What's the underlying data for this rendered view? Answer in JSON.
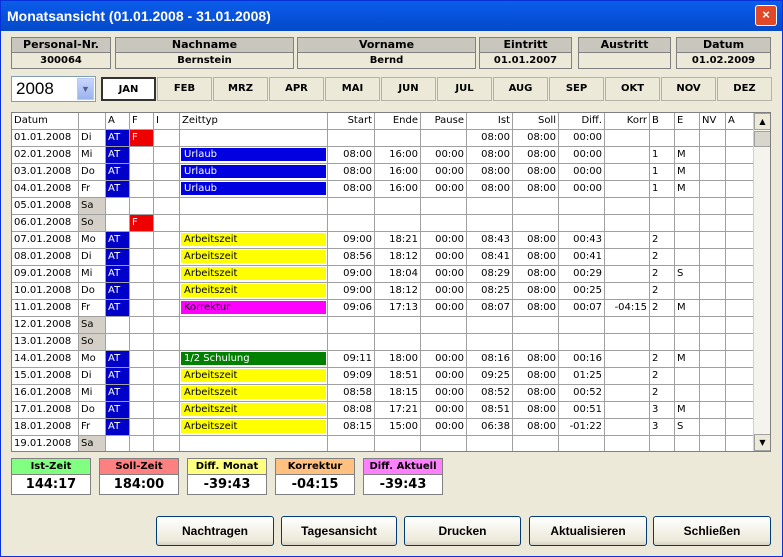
{
  "window": {
    "title": "Monatsansicht (01.01.2008 - 31.01.2008)",
    "close": "×"
  },
  "header": [
    {
      "label": "Personal-Nr.",
      "value": "300064"
    },
    {
      "label": "Nachname",
      "value": "Bernstein"
    },
    {
      "label": "Vorname",
      "value": "Bernd"
    },
    {
      "label": "Eintritt",
      "value": "01.01.2007"
    },
    {
      "label": "Austritt",
      "value": ""
    },
    {
      "label": "Datum",
      "value": "01.02.2009"
    }
  ],
  "year": "2008",
  "months": [
    "JAN",
    "FEB",
    "MRZ",
    "APR",
    "MAI",
    "JUN",
    "JUL",
    "AUG",
    "SEP",
    "OKT",
    "NOV",
    "DEZ"
  ],
  "selected_month": "JAN",
  "columns": [
    "Datum",
    "",
    "A",
    "F",
    "I",
    "Zeittyp",
    "Start",
    "Ende",
    "Pause",
    "Ist",
    "Soll",
    "Diff.",
    "Korr",
    "B",
    "E",
    "NV",
    "A"
  ],
  "rows": [
    {
      "datum": "01.01.2008",
      "tag": "Di",
      "a": "AT",
      "f": "F",
      "zt": "",
      "zc": "",
      "start": "",
      "ende": "",
      "pause": "",
      "ist": "08:00",
      "soll": "08:00",
      "diff": "00:00",
      "korr": "",
      "b": "",
      "e": ""
    },
    {
      "datum": "02.01.2008",
      "tag": "Mi",
      "a": "AT",
      "f": "",
      "zt": "Urlaub",
      "zc": "#0000e0",
      "start": "08:00",
      "ende": "16:00",
      "pause": "00:00",
      "ist": "08:00",
      "soll": "08:00",
      "diff": "00:00",
      "korr": "",
      "b": "1",
      "e": "M"
    },
    {
      "datum": "03.01.2008",
      "tag": "Do",
      "a": "AT",
      "f": "",
      "zt": "Urlaub",
      "zc": "#0000e0",
      "start": "08:00",
      "ende": "16:00",
      "pause": "00:00",
      "ist": "08:00",
      "soll": "08:00",
      "diff": "00:00",
      "korr": "",
      "b": "1",
      "e": "M"
    },
    {
      "datum": "04.01.2008",
      "tag": "Fr",
      "a": "AT",
      "f": "",
      "zt": "Urlaub",
      "zc": "#0000e0",
      "start": "08:00",
      "ende": "16:00",
      "pause": "00:00",
      "ist": "08:00",
      "soll": "08:00",
      "diff": "00:00",
      "korr": "",
      "b": "1",
      "e": "M"
    },
    {
      "datum": "05.01.2008",
      "tag": "Sa",
      "a": "",
      "f": "",
      "zt": "",
      "zc": "",
      "start": "",
      "ende": "",
      "pause": "",
      "ist": "",
      "soll": "",
      "diff": "",
      "korr": "",
      "b": "",
      "e": ""
    },
    {
      "datum": "06.01.2008",
      "tag": "So",
      "a": "",
      "f": "F",
      "zt": "",
      "zc": "",
      "start": "",
      "ende": "",
      "pause": "",
      "ist": "",
      "soll": "",
      "diff": "",
      "korr": "",
      "b": "",
      "e": ""
    },
    {
      "datum": "07.01.2008",
      "tag": "Mo",
      "a": "AT",
      "f": "",
      "zt": "Arbeitszeit",
      "zc": "#ffff00",
      "start": "09:00",
      "ende": "18:21",
      "pause": "00:00",
      "ist": "08:43",
      "soll": "08:00",
      "diff": "00:43",
      "korr": "",
      "b": "2",
      "e": ""
    },
    {
      "datum": "08.01.2008",
      "tag": "Di",
      "a": "AT",
      "f": "",
      "zt": "Arbeitszeit",
      "zc": "#ffff00",
      "start": "08:56",
      "ende": "18:12",
      "pause": "00:00",
      "ist": "08:41",
      "soll": "08:00",
      "diff": "00:41",
      "korr": "",
      "b": "2",
      "e": ""
    },
    {
      "datum": "09.01.2008",
      "tag": "Mi",
      "a": "AT",
      "f": "",
      "zt": "Arbeitszeit",
      "zc": "#ffff00",
      "start": "09:00",
      "ende": "18:04",
      "pause": "00:00",
      "ist": "08:29",
      "soll": "08:00",
      "diff": "00:29",
      "korr": "",
      "b": "2",
      "e": "S"
    },
    {
      "datum": "10.01.2008",
      "tag": "Do",
      "a": "AT",
      "f": "",
      "zt": "Arbeitszeit",
      "zc": "#ffff00",
      "start": "09:00",
      "ende": "18:12",
      "pause": "00:00",
      "ist": "08:25",
      "soll": "08:00",
      "diff": "00:25",
      "korr": "",
      "b": "2",
      "e": ""
    },
    {
      "datum": "11.01.2008",
      "tag": "Fr",
      "a": "AT",
      "f": "",
      "zt": "Korrektur",
      "zc": "#ff00ff",
      "start": "09:06",
      "ende": "17:13",
      "pause": "00:00",
      "ist": "08:07",
      "soll": "08:00",
      "diff": "00:07",
      "korr": "-04:15",
      "b": "2",
      "e": "M"
    },
    {
      "datum": "12.01.2008",
      "tag": "Sa",
      "a": "",
      "f": "",
      "zt": "",
      "zc": "",
      "start": "",
      "ende": "",
      "pause": "",
      "ist": "",
      "soll": "",
      "diff": "",
      "korr": "",
      "b": "",
      "e": ""
    },
    {
      "datum": "13.01.2008",
      "tag": "So",
      "a": "",
      "f": "",
      "zt": "",
      "zc": "",
      "start": "",
      "ende": "",
      "pause": "",
      "ist": "",
      "soll": "",
      "diff": "",
      "korr": "",
      "b": "",
      "e": ""
    },
    {
      "datum": "14.01.2008",
      "tag": "Mo",
      "a": "AT",
      "f": "",
      "zt": "1/2 Schulung",
      "zc": "#008000",
      "start": "09:11",
      "ende": "18:00",
      "pause": "00:00",
      "ist": "08:16",
      "soll": "08:00",
      "diff": "00:16",
      "korr": "",
      "b": "2",
      "e": "M"
    },
    {
      "datum": "15.01.2008",
      "tag": "Di",
      "a": "AT",
      "f": "",
      "zt": "Arbeitszeit",
      "zc": "#ffff00",
      "start": "09:09",
      "ende": "18:51",
      "pause": "00:00",
      "ist": "09:25",
      "soll": "08:00",
      "diff": "01:25",
      "korr": "",
      "b": "2",
      "e": ""
    },
    {
      "datum": "16.01.2008",
      "tag": "Mi",
      "a": "AT",
      "f": "",
      "zt": "Arbeitszeit",
      "zc": "#ffff00",
      "start": "08:58",
      "ende": "18:15",
      "pause": "00:00",
      "ist": "08:52",
      "soll": "08:00",
      "diff": "00:52",
      "korr": "",
      "b": "2",
      "e": ""
    },
    {
      "datum": "17.01.2008",
      "tag": "Do",
      "a": "AT",
      "f": "",
      "zt": "Arbeitszeit",
      "zc": "#ffff00",
      "start": "08:08",
      "ende": "17:21",
      "pause": "00:00",
      "ist": "08:51",
      "soll": "08:00",
      "diff": "00:51",
      "korr": "",
      "b": "3",
      "e": "M"
    },
    {
      "datum": "18.01.2008",
      "tag": "Fr",
      "a": "AT",
      "f": "",
      "zt": "Arbeitszeit",
      "zc": "#ffff00",
      "start": "08:15",
      "ende": "15:00",
      "pause": "00:00",
      "ist": "06:38",
      "soll": "08:00",
      "diff": "-01:22",
      "korr": "",
      "b": "3",
      "e": "S"
    },
    {
      "datum": "19.01.2008",
      "tag": "Sa",
      "a": "",
      "f": "",
      "zt": "",
      "zc": "",
      "start": "",
      "ende": "",
      "pause": "",
      "ist": "",
      "soll": "",
      "diff": "",
      "korr": "",
      "b": "",
      "e": ""
    }
  ],
  "scroll": {
    "up": "▲",
    "down": "▼"
  },
  "summary": [
    {
      "label": "Ist-Zeit",
      "value": "144:17",
      "color": "#80ff80"
    },
    {
      "label": "Soll-Zeit",
      "value": "184:00",
      "color": "#ff8080"
    },
    {
      "label": "Diff. Monat",
      "value": "-39:43",
      "color": "#ffff80"
    },
    {
      "label": "Korrektur",
      "value": "-04:15",
      "color": "#ffc080"
    },
    {
      "label": "Diff. Aktuell",
      "value": "-39:43",
      "color": "#ff80ff"
    }
  ],
  "buttons": [
    "Nachtragen",
    "Tagesansicht",
    "Drucken",
    "Aktualisieren",
    "Schließen"
  ]
}
